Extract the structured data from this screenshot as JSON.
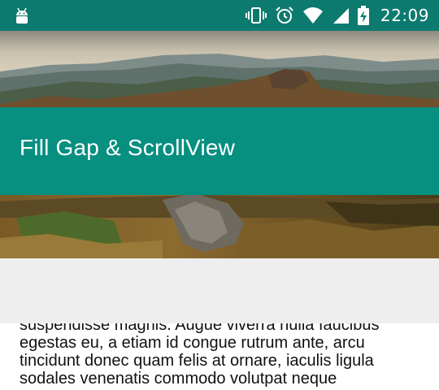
{
  "status_bar": {
    "time": "22:09",
    "icons": [
      "android-icon",
      "vibrate-icon",
      "alarm-icon",
      "wifi-icon",
      "signal-icon",
      "battery-charging-icon"
    ]
  },
  "toolbar": {
    "title": "Fill Gap & ScrollView"
  },
  "content": {
    "body": "suspendisse magnis. Augue viverra nulla faucibus egestas eu, a etiam id congue rutrum ante, arcu tincidunt donec quam felis at ornare, iaculis ligula sodales venenatis commodo volutpat neque"
  },
  "colors": {
    "status_bar": "#0d7a6f",
    "toolbar": "#078f80",
    "gap": "#eeeeee"
  }
}
